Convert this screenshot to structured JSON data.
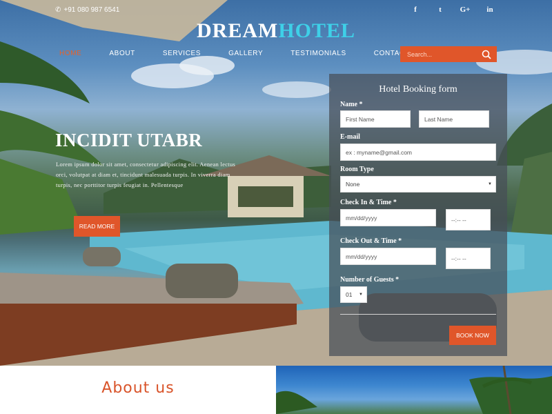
{
  "topbar": {
    "phone": "+91 080 987 6541",
    "social": [
      {
        "icon": "facebook-icon",
        "glyph": "f"
      },
      {
        "icon": "twitter-icon",
        "glyph": "t"
      },
      {
        "icon": "google-plus-icon",
        "glyph": "G+"
      },
      {
        "icon": "linkedin-icon",
        "glyph": "in"
      }
    ]
  },
  "logo": {
    "part1": "DREAM",
    "part2": "HOTEL"
  },
  "nav": {
    "items": [
      "HOME",
      "ABOUT",
      "SERVICES",
      "GALLERY",
      "TESTIMONIALS",
      "CONTACT US"
    ],
    "active": "HOME"
  },
  "search": {
    "placeholder": "Search..."
  },
  "hero": {
    "title": "INCIDIT UTABR",
    "description": "Lorem ipsum dolor sit amet, consectetur adipiscing elit. Aenean lectus orci, volutpat at diam et, tincidunt malesuada turpis. In viverra diam turpis, nec porttitor turpis feugiat in. Pellentesque",
    "read_more": "READ MORE"
  },
  "booking_form": {
    "title": "Hotel Booking form",
    "name_label": "Name *",
    "first_name_placeholder": "First Name",
    "last_name_placeholder": "Last Name",
    "email_label": "E-mail",
    "email_placeholder": "ex : myname@gmail.com",
    "room_type_label": "Room Type",
    "room_type_value": "None",
    "checkin_label": "Check In & Time *",
    "checkin_date_placeholder": "mm/dd/yyyy",
    "checkin_time_placeholder": "--:-- --",
    "checkout_label": "Check Out & Time *",
    "checkout_date_placeholder": "mm/dd/yyyy",
    "checkout_time_placeholder": "--:-- --",
    "guests_label": "Number of Guests *",
    "guests_value": "01",
    "submit": "BOOK NOW"
  },
  "about": {
    "title": "About us"
  },
  "colors": {
    "accent": "#e0562a",
    "logo_secondary": "#3ed0e8",
    "about_title": "#d9542a"
  }
}
